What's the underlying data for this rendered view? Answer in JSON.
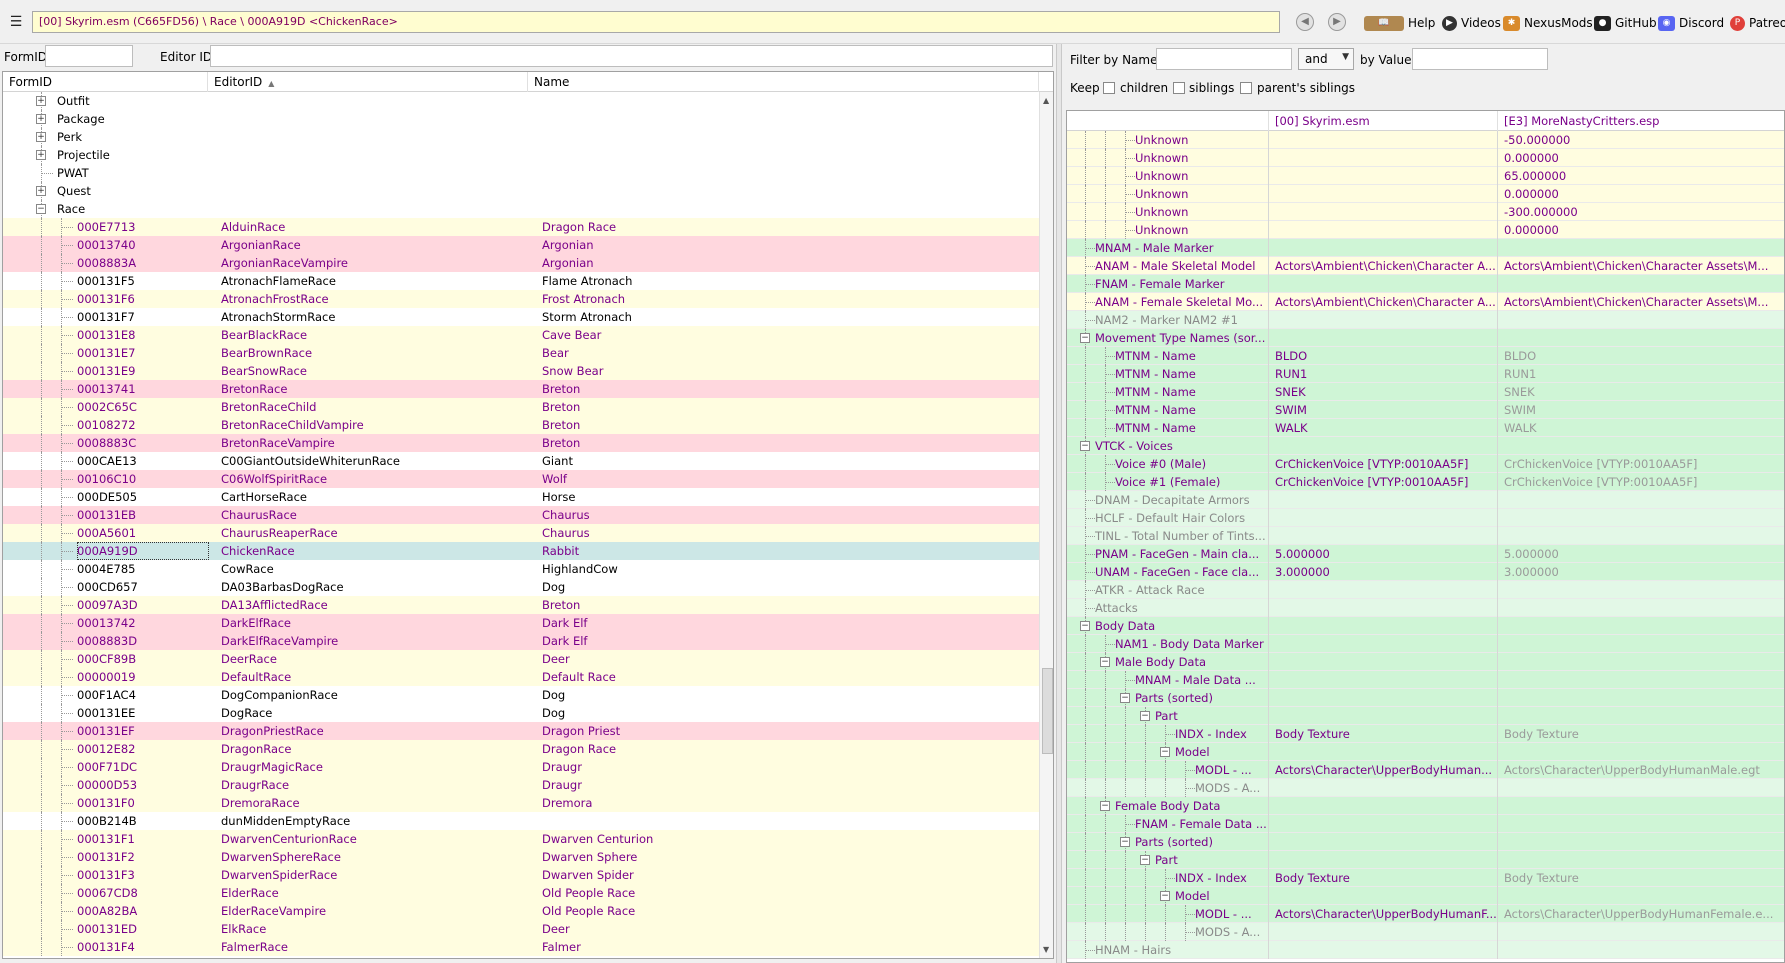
{
  "toolbar": {
    "path": "[00] Skyrim.esm (C665FD56) \\ Race \\ 000A919D <ChickenRace>",
    "links": [
      {
        "label": "Help",
        "icon": "book-icon"
      },
      {
        "label": "Videos",
        "icon": "video-icon"
      },
      {
        "label": "NexusMods",
        "icon": "nexusmods-icon"
      },
      {
        "label": "GitHub",
        "icon": "github-icon"
      },
      {
        "label": "Discord",
        "icon": "discord-icon"
      },
      {
        "label": "Patreo",
        "icon": "patreon-icon"
      }
    ]
  },
  "left": {
    "formid_label": "FormID",
    "editorid_label": "Editor ID",
    "formid_value": "",
    "editorid_value": "",
    "columns": [
      "FormID",
      "EditorID",
      "Name"
    ],
    "groups": [
      "Outfit",
      "Package",
      "Perk",
      "Projectile",
      "PWAT",
      "Quest",
      "Race"
    ],
    "rows": [
      {
        "formid": "000E7713",
        "editorid": "AlduinRace",
        "name": "Dragon Race",
        "hl": "yellow",
        "c": "purple"
      },
      {
        "formid": "00013740",
        "editorid": "ArgonianRace",
        "name": "Argonian",
        "hl": "red",
        "c": "purple"
      },
      {
        "formid": "0008883A",
        "editorid": "ArgonianRaceVampire",
        "name": "Argonian",
        "hl": "red",
        "c": "purple"
      },
      {
        "formid": "000131F5",
        "editorid": "AtronachFlameRace",
        "name": "Flame Atronach",
        "hl": "white",
        "c": "black"
      },
      {
        "formid": "000131F6",
        "editorid": "AtronachFrostRace",
        "name": "Frost Atronach",
        "hl": "yellow",
        "c": "purple"
      },
      {
        "formid": "000131F7",
        "editorid": "AtronachStormRace",
        "name": "Storm Atronach",
        "hl": "white",
        "c": "black"
      },
      {
        "formid": "000131E8",
        "editorid": "BearBlackRace",
        "name": "Cave Bear",
        "hl": "yellow",
        "c": "purple"
      },
      {
        "formid": "000131E7",
        "editorid": "BearBrownRace",
        "name": "Bear",
        "hl": "yellow",
        "c": "purple"
      },
      {
        "formid": "000131E9",
        "editorid": "BearSnowRace",
        "name": "Snow Bear",
        "hl": "yellow",
        "c": "purple"
      },
      {
        "formid": "00013741",
        "editorid": "BretonRace",
        "name": "Breton",
        "hl": "red",
        "c": "purple"
      },
      {
        "formid": "0002C65C",
        "editorid": "BretonRaceChild",
        "name": "Breton",
        "hl": "yellow",
        "c": "purple"
      },
      {
        "formid": "00108272",
        "editorid": "BretonRaceChildVampire",
        "name": "Breton",
        "hl": "yellow",
        "c": "purple"
      },
      {
        "formid": "0008883C",
        "editorid": "BretonRaceVampire",
        "name": "Breton",
        "hl": "red",
        "c": "purple"
      },
      {
        "formid": "000CAE13",
        "editorid": "C00GiantOutsideWhiterunRace",
        "name": "Giant",
        "hl": "white",
        "c": "black"
      },
      {
        "formid": "00106C10",
        "editorid": "C06WolfSpiritRace",
        "name": "Wolf",
        "hl": "red",
        "c": "purple"
      },
      {
        "formid": "000DE505",
        "editorid": "CartHorseRace",
        "name": "Horse",
        "hl": "white",
        "c": "black"
      },
      {
        "formid": "000131EB",
        "editorid": "ChaurusRace",
        "name": "Chaurus",
        "hl": "red",
        "c": "purple"
      },
      {
        "formid": "000A5601",
        "editorid": "ChaurusReaperRace",
        "name": "Chaurus",
        "hl": "yellow",
        "c": "purple"
      },
      {
        "formid": "000A919D",
        "editorid": "ChickenRace",
        "name": "Rabbit",
        "hl": "teal",
        "c": "purple"
      },
      {
        "formid": "0004E785",
        "editorid": "CowRace",
        "name": "HighlandCow",
        "hl": "white",
        "c": "black"
      },
      {
        "formid": "000CD657",
        "editorid": "DA03BarbasDogRace",
        "name": "Dog",
        "hl": "white",
        "c": "black"
      },
      {
        "formid": "00097A3D",
        "editorid": "DA13AfflictedRace",
        "name": "Breton",
        "hl": "yellow",
        "c": "purple"
      },
      {
        "formid": "00013742",
        "editorid": "DarkElfRace",
        "name": "Dark Elf",
        "hl": "red",
        "c": "purple"
      },
      {
        "formid": "0008883D",
        "editorid": "DarkElfRaceVampire",
        "name": "Dark Elf",
        "hl": "red",
        "c": "purple"
      },
      {
        "formid": "000CF89B",
        "editorid": "DeerRace",
        "name": "Deer",
        "hl": "yellow",
        "c": "purple"
      },
      {
        "formid": "00000019",
        "editorid": "DefaultRace",
        "name": "Default Race",
        "hl": "yellow",
        "c": "purple"
      },
      {
        "formid": "000F1AC4",
        "editorid": "DogCompanionRace",
        "name": "Dog",
        "hl": "white",
        "c": "black"
      },
      {
        "formid": "000131EE",
        "editorid": "DogRace",
        "name": "Dog",
        "hl": "white",
        "c": "black"
      },
      {
        "formid": "000131EF",
        "editorid": "DragonPriestRace",
        "name": "Dragon Priest",
        "hl": "red",
        "c": "purple"
      },
      {
        "formid": "00012E82",
        "editorid": "DragonRace",
        "name": "Dragon Race",
        "hl": "yellow",
        "c": "purple"
      },
      {
        "formid": "000F71DC",
        "editorid": "DraugrMagicRace",
        "name": "Draugr",
        "hl": "yellow",
        "c": "purple"
      },
      {
        "formid": "00000D53",
        "editorid": "DraugrRace",
        "name": "Draugr",
        "hl": "yellow",
        "c": "purple"
      },
      {
        "formid": "000131F0",
        "editorid": "DremoraRace",
        "name": "Dremora",
        "hl": "yellow",
        "c": "purple"
      },
      {
        "formid": "000B214B",
        "editorid": "dunMiddenEmptyRace",
        "name": "",
        "hl": "white",
        "c": "black"
      },
      {
        "formid": "000131F1",
        "editorid": "DwarvenCenturionRace",
        "name": "Dwarven Centurion",
        "hl": "yellow",
        "c": "purple"
      },
      {
        "formid": "000131F2",
        "editorid": "DwarvenSphereRace",
        "name": "Dwarven Sphere",
        "hl": "yellow",
        "c": "purple"
      },
      {
        "formid": "000131F3",
        "editorid": "DwarvenSpiderRace",
        "name": "Dwarven Spider",
        "hl": "yellow",
        "c": "purple"
      },
      {
        "formid": "00067CD8",
        "editorid": "ElderRace",
        "name": "Old People Race",
        "hl": "yellow",
        "c": "purple"
      },
      {
        "formid": "000A82BA",
        "editorid": "ElderRaceVampire",
        "name": "Old People Race",
        "hl": "yellow",
        "c": "purple"
      },
      {
        "formid": "000131ED",
        "editorid": "ElkRace",
        "name": "Deer",
        "hl": "yellow",
        "c": "purple"
      },
      {
        "formid": "000131F4",
        "editorid": "FalmerRace",
        "name": "Falmer",
        "hl": "yellow",
        "c": "purple"
      }
    ]
  },
  "right": {
    "filter_name_label": "Filter by Name:",
    "filter_name_value": "",
    "filter_op": "and",
    "filter_value_label": "by Value:",
    "filter_value_value": "",
    "keep_label": "Keep",
    "keep_children": "children",
    "keep_siblings": "siblings",
    "keep_parents": "parent's siblings",
    "col1": "[00] Skyrim.esm",
    "col2": "[E3] MoreNastyCritters.esp",
    "rows": [
      {
        "label": "Unknown",
        "v1": "",
        "v2": "-50.000000",
        "indent": 3,
        "bg": "yellow",
        "c": "purple"
      },
      {
        "label": "Unknown",
        "v1": "",
        "v2": "0.000000",
        "indent": 3,
        "bg": "yellow",
        "c": "purple"
      },
      {
        "label": "Unknown",
        "v1": "",
        "v2": "65.000000",
        "indent": 3,
        "bg": "yellow",
        "c": "purple"
      },
      {
        "label": "Unknown",
        "v1": "",
        "v2": "0.000000",
        "indent": 3,
        "bg": "yellow",
        "c": "purple"
      },
      {
        "label": "Unknown",
        "v1": "",
        "v2": "-300.000000",
        "indent": 3,
        "bg": "yellow",
        "c": "purple"
      },
      {
        "label": "Unknown",
        "v1": "",
        "v2": "0.000000",
        "indent": 3,
        "bg": "yellow",
        "c": "purple"
      },
      {
        "label": "MNAM - Male Marker",
        "v1": "",
        "v2": "",
        "indent": 1,
        "bg": "green",
        "c": "purple"
      },
      {
        "label": "ANAM - Male Skeletal Model",
        "v1": "Actors\\Ambient\\Chicken\\Character A...",
        "v2": "Actors\\Ambient\\Chicken\\Character Assets\\M...",
        "indent": 1,
        "bg": "yellow",
        "c": "purple"
      },
      {
        "label": "FNAM - Female Marker",
        "v1": "",
        "v2": "",
        "indent": 1,
        "bg": "green",
        "c": "purple"
      },
      {
        "label": "ANAM - Female Skeletal Mo...",
        "v1": "Actors\\Ambient\\Chicken\\Character A...",
        "v2": "Actors\\Ambient\\Chicken\\Character Assets\\M...",
        "indent": 1,
        "bg": "yellow",
        "c": "purple"
      },
      {
        "label": "NAM2 - Marker NAM2 #1",
        "v1": "",
        "v2": "",
        "indent": 1,
        "bg": "greenlight",
        "c": "gray"
      },
      {
        "label": "Movement Type Names (sor...",
        "v1": "",
        "v2": "",
        "indent": 1,
        "bg": "green",
        "c": "purple",
        "exp": true
      },
      {
        "label": "MTNM - Name",
        "v1": "BLDO",
        "v2": "BLDO",
        "indent": 2,
        "bg": "green",
        "c": "purple"
      },
      {
        "label": "MTNM - Name",
        "v1": "RUN1",
        "v2": "RUN1",
        "indent": 2,
        "bg": "green",
        "c": "purple"
      },
      {
        "label": "MTNM - Name",
        "v1": "SNEK",
        "v2": "SNEK",
        "indent": 2,
        "bg": "green",
        "c": "purple"
      },
      {
        "label": "MTNM - Name",
        "v1": "SWIM",
        "v2": "SWIM",
        "indent": 2,
        "bg": "green",
        "c": "purple"
      },
      {
        "label": "MTNM - Name",
        "v1": "WALK",
        "v2": "WALK",
        "indent": 2,
        "bg": "green",
        "c": "purple"
      },
      {
        "label": "VTCK - Voices",
        "v1": "",
        "v2": "",
        "indent": 1,
        "bg": "green",
        "c": "purple",
        "exp": true
      },
      {
        "label": "Voice #0 (Male)",
        "v1": "CrChickenVoice [VTYP:0010AA5F]",
        "v2": "CrChickenVoice [VTYP:0010AA5F]",
        "indent": 2,
        "bg": "green",
        "c": "purple"
      },
      {
        "label": "Voice #1 (Female)",
        "v1": "CrChickenVoice [VTYP:0010AA5F]",
        "v2": "CrChickenVoice [VTYP:0010AA5F]",
        "indent": 2,
        "bg": "green",
        "c": "purple"
      },
      {
        "label": "DNAM - Decapitate Armors",
        "v1": "",
        "v2": "",
        "indent": 1,
        "bg": "greenlight",
        "c": "gray"
      },
      {
        "label": "HCLF - Default Hair Colors",
        "v1": "",
        "v2": "",
        "indent": 1,
        "bg": "greenlight",
        "c": "gray"
      },
      {
        "label": "TINL - Total Number of Tints...",
        "v1": "",
        "v2": "",
        "indent": 1,
        "bg": "greenlight",
        "c": "gray"
      },
      {
        "label": "PNAM - FaceGen - Main cla...",
        "v1": "5.000000",
        "v2": "5.000000",
        "indent": 1,
        "bg": "green",
        "c": "purple"
      },
      {
        "label": "UNAM - FaceGen - Face cla...",
        "v1": "3.000000",
        "v2": "3.000000",
        "indent": 1,
        "bg": "green",
        "c": "purple"
      },
      {
        "label": "ATKR - Attack Race",
        "v1": "",
        "v2": "",
        "indent": 1,
        "bg": "greenlight",
        "c": "gray"
      },
      {
        "label": "Attacks",
        "v1": "",
        "v2": "",
        "indent": 1,
        "bg": "greenlight",
        "c": "gray"
      },
      {
        "label": "Body Data",
        "v1": "",
        "v2": "",
        "indent": 1,
        "bg": "green",
        "c": "purple",
        "exp": true
      },
      {
        "label": "NAM1 - Body Data Marker",
        "v1": "",
        "v2": "",
        "indent": 2,
        "bg": "green",
        "c": "purple"
      },
      {
        "label": "Male Body Data",
        "v1": "",
        "v2": "",
        "indent": 2,
        "bg": "green",
        "c": "purple",
        "exp": true
      },
      {
        "label": "MNAM - Male Data ...",
        "v1": "",
        "v2": "",
        "indent": 3,
        "bg": "green",
        "c": "purple"
      },
      {
        "label": "Parts (sorted)",
        "v1": "",
        "v2": "",
        "indent": 3,
        "bg": "green",
        "c": "purple",
        "exp": true
      },
      {
        "label": "Part",
        "v1": "",
        "v2": "",
        "indent": 4,
        "bg": "green",
        "c": "purple",
        "exp": true
      },
      {
        "label": "INDX - Index",
        "v1": "Body Texture",
        "v2": "Body Texture",
        "indent": 5,
        "bg": "green",
        "c": "purple"
      },
      {
        "label": "Model",
        "v1": "",
        "v2": "",
        "indent": 5,
        "bg": "green",
        "c": "purple",
        "exp": true
      },
      {
        "label": "MODL - ...",
        "v1": "Actors\\Character\\UpperBodyHuman...",
        "v2": "Actors\\Character\\UpperBodyHumanMale.egt",
        "indent": 6,
        "bg": "green",
        "c": "purple"
      },
      {
        "label": "MODS - A...",
        "v1": "",
        "v2": "",
        "indent": 6,
        "bg": "greenlight",
        "c": "gray"
      },
      {
        "label": "Female Body Data",
        "v1": "",
        "v2": "",
        "indent": 2,
        "bg": "green",
        "c": "purple",
        "exp": true
      },
      {
        "label": "FNAM - Female Data ...",
        "v1": "",
        "v2": "",
        "indent": 3,
        "bg": "green",
        "c": "purple"
      },
      {
        "label": "Parts (sorted)",
        "v1": "",
        "v2": "",
        "indent": 3,
        "bg": "green",
        "c": "purple",
        "exp": true
      },
      {
        "label": "Part",
        "v1": "",
        "v2": "",
        "indent": 4,
        "bg": "green",
        "c": "purple",
        "exp": true
      },
      {
        "label": "INDX - Index",
        "v1": "Body Texture",
        "v2": "Body Texture",
        "indent": 5,
        "bg": "green",
        "c": "purple"
      },
      {
        "label": "Model",
        "v1": "",
        "v2": "",
        "indent": 5,
        "bg": "green",
        "c": "purple",
        "exp": true
      },
      {
        "label": "MODL - ...",
        "v1": "Actors\\Character\\UpperBodyHumanF...",
        "v2": "Actors\\Character\\UpperBodyHumanFemale.e...",
        "indent": 6,
        "bg": "green",
        "c": "purple"
      },
      {
        "label": "MODS - A...",
        "v1": "",
        "v2": "",
        "indent": 6,
        "bg": "greenlight",
        "c": "gray"
      },
      {
        "label": "HNAM - Hairs",
        "v1": "",
        "v2": "",
        "indent": 1,
        "bg": "greenlight",
        "c": "gray"
      }
    ]
  }
}
